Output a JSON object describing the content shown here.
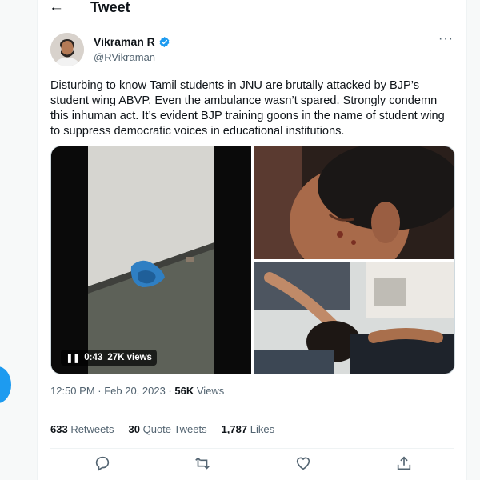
{
  "header": {
    "title": "Tweet"
  },
  "author": {
    "name": "Vikraman R",
    "handle": "@RVikraman"
  },
  "tweet": {
    "text": "Disturbing to know Tamil students in JNU are brutally attacked by BJP’s student wing ABVP. Even the ambulance wasn’t spared. Strongly condemn this inhuman act. It’s evident BJP training goons in the name of student wing to suppress democratic voices in educational institutions."
  },
  "video": {
    "duration": "0:43",
    "views": "27K views"
  },
  "meta": {
    "time_date": "12:50 PM · Feb 20, 2023 · ",
    "views_count": "56K",
    "views_label": " Views"
  },
  "stats": {
    "retweets_count": "633",
    "retweets_label": " Retweets",
    "quotes_count": "30",
    "quotes_label": " Quote Tweets",
    "likes_count": "1,787",
    "likes_label": " Likes"
  },
  "icons": {
    "back": "arrow-left-icon",
    "verified": "verified-badge-icon",
    "more": "more-icon",
    "reply": "reply-icon",
    "retweet": "retweet-icon",
    "like": "heart-icon",
    "share": "share-icon"
  },
  "colors": {
    "accent": "#1d9bf0",
    "text": "#0f1419",
    "secondary": "#536471"
  }
}
